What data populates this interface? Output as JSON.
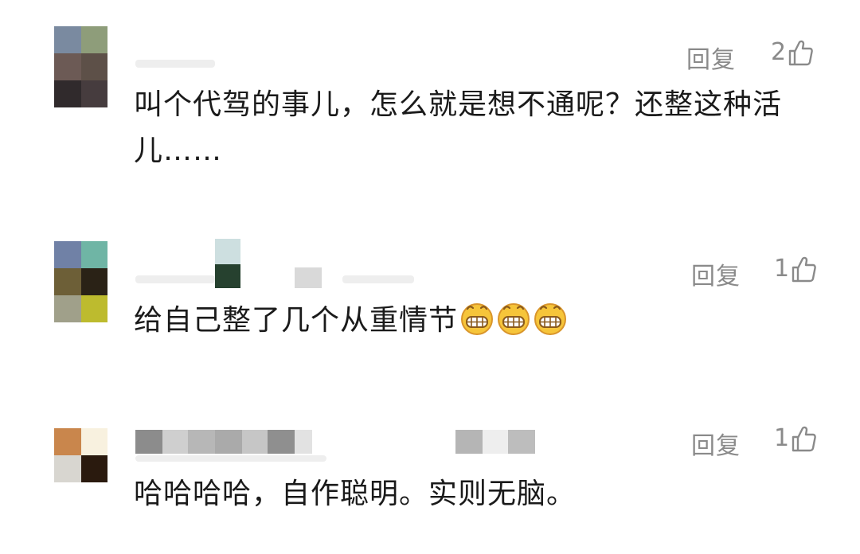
{
  "comments": [
    {
      "id": "c1",
      "reply_label": "回复",
      "like_count": "2",
      "text": "叫个代驾的事儿，怎么就是想不通呢？还整这种活儿……",
      "emoji_count": 0
    },
    {
      "id": "c2",
      "reply_label": "回复",
      "like_count": "1",
      "text": "给自己整了几个从重情节",
      "emoji_count": 3,
      "emoji_name": "grin-emoji"
    },
    {
      "id": "c3",
      "reply_label": "回复",
      "like_count": "1",
      "text": "哈哈哈哈，自作聪明。实则无脑。",
      "emoji_count": 0
    }
  ],
  "colors": {
    "text": "#1a1a1a",
    "meta": "#8a8a8a",
    "emoji_face": "#f6c53a"
  },
  "icons": {
    "like": "thumbs-up-icon",
    "emoji": "grin-emoji"
  }
}
